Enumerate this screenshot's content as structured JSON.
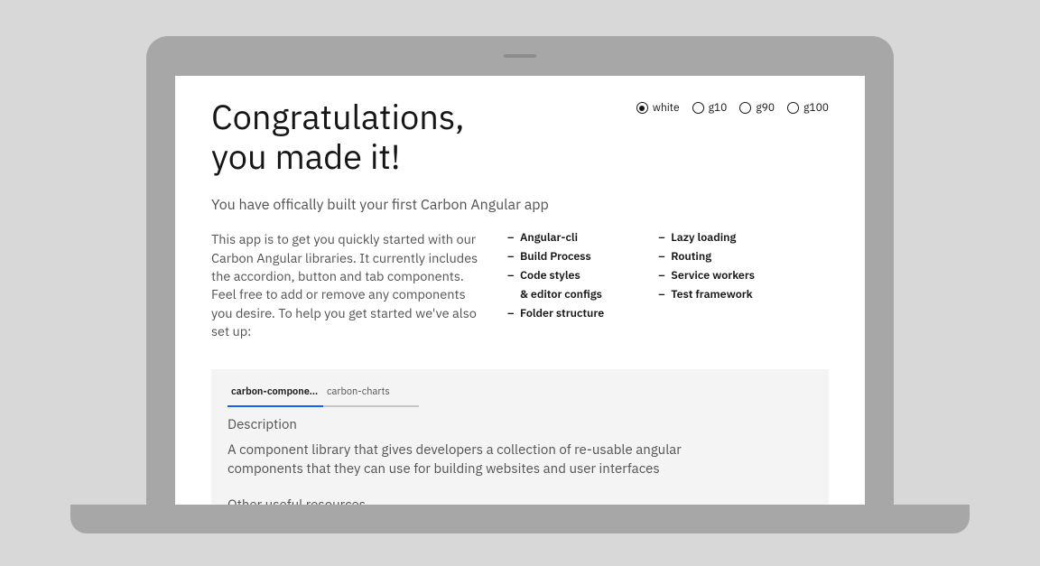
{
  "headline": {
    "line1": "Congratulations,",
    "line2": "you made it!"
  },
  "theme_options": [
    {
      "label": "white",
      "selected": true
    },
    {
      "label": "g10",
      "selected": false
    },
    {
      "label": "g90",
      "selected": false
    },
    {
      "label": "g100",
      "selected": false
    }
  ],
  "subhead": "You have offically built your first Carbon Angular app",
  "intro": "This app is to get you quickly started with our Carbon Angular libraries. It currently includes the accordion, button and tab components. Feel free to add or remove any components you desire. To help you get started we've also set up:",
  "features_col1": [
    "Angular-cli",
    "Build Process",
    "Code styles",
    "& editor configs",
    "Folder structure"
  ],
  "features_col2": [
    "Lazy loading",
    "Routing",
    "Service workers",
    "Test framework"
  ],
  "tabs": [
    {
      "label": "carbon-compone…",
      "active": true
    },
    {
      "label": "carbon-charts",
      "active": false
    }
  ],
  "panel": {
    "section_label": "Description",
    "description": "A component library that gives developers a collection of re-usable angular components that they can use for building websites and user interfaces",
    "resources_label": "Other useful resources"
  }
}
